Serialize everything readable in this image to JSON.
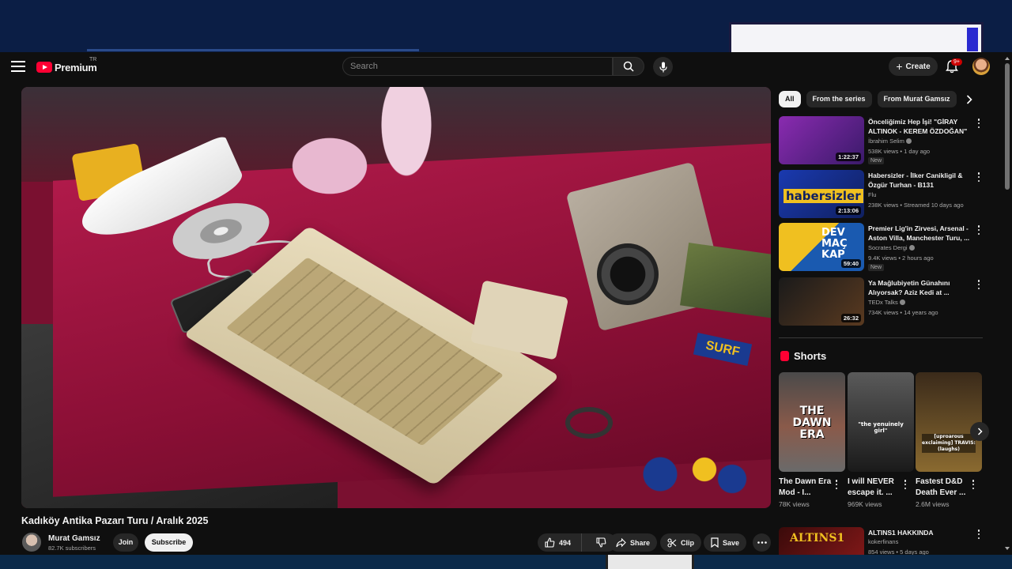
{
  "header": {
    "logo_text": "Premium",
    "logo_super": "TR",
    "search_placeholder": "Search",
    "create_label": "Create",
    "notification_count": "9+"
  },
  "video": {
    "title": "Kadıköy Antika Pazarı Turu / Aralık 2025",
    "overlay_text": "SURF",
    "channel": {
      "name": "Murat Gamsız",
      "subscribers": "82.7K subscribers",
      "join_label": "Join",
      "subscribe_label": "Subscribe"
    },
    "actions": {
      "likes": "494",
      "share_label": "Share",
      "clip_label": "Clip",
      "save_label": "Save"
    }
  },
  "chips": [
    "All",
    "From the series",
    "From Murat Gamsız"
  ],
  "recommendations": [
    {
      "title": "Önceliğimiz Hep İşi! \"GİRAY ALTINOK - KEREM ÖZDOĞAN\" ...",
      "channel": "İbrahim Selim",
      "meta": "538K views • 1 day ago",
      "duration": "1:22:37",
      "badge": "New"
    },
    {
      "title": "Habersizler - İlker Canikligil & Özgür Turhan - B131",
      "channel": "Flu",
      "meta": "238K views • Streamed 10 days ago",
      "duration": "2:13:06",
      "thumb_text": "habersizler"
    },
    {
      "title": "Premier Lig'in Zirvesi, Arsenal - Aston Villa, Manchester Turu, ...",
      "channel": "Socrates Dergi",
      "meta": "9.4K views • 2 hours ago",
      "duration": "59:40",
      "badge": "New",
      "thumb_text": "DEV MAÇ KAP"
    },
    {
      "title": "Ya Mağlubiyetin Günahını Alıyorsak? Aziz Kedi at ...",
      "channel": "TEDx Talks",
      "meta": "734K views • 14 years ago",
      "duration": "26:32"
    }
  ],
  "shorts": {
    "heading": "Shorts",
    "items": [
      {
        "title": "The Dawn Era Mod - I...",
        "views": "78K views",
        "thumb_text": "THE DAWN ERA"
      },
      {
        "title": "I will NEVER escape it. ...",
        "views": "969K views",
        "thumb_text": "\"the yenuinely girl\""
      },
      {
        "title": "Fastest D&D Death Ever ...",
        "views": "2.6M views",
        "thumb_text": "[uproarous exclaiming] TRAVIS: (laughs)"
      }
    ]
  },
  "rec_bottom": {
    "title": "ALTINS1 HAKKINDA",
    "channel": "kokerfinans",
    "meta": "854 views • 5 days ago",
    "thumb_text": "ALTINS1"
  },
  "colors": {
    "brand": "#ff0033",
    "background": "#0f0f0f",
    "chip_bg": "#272727"
  }
}
